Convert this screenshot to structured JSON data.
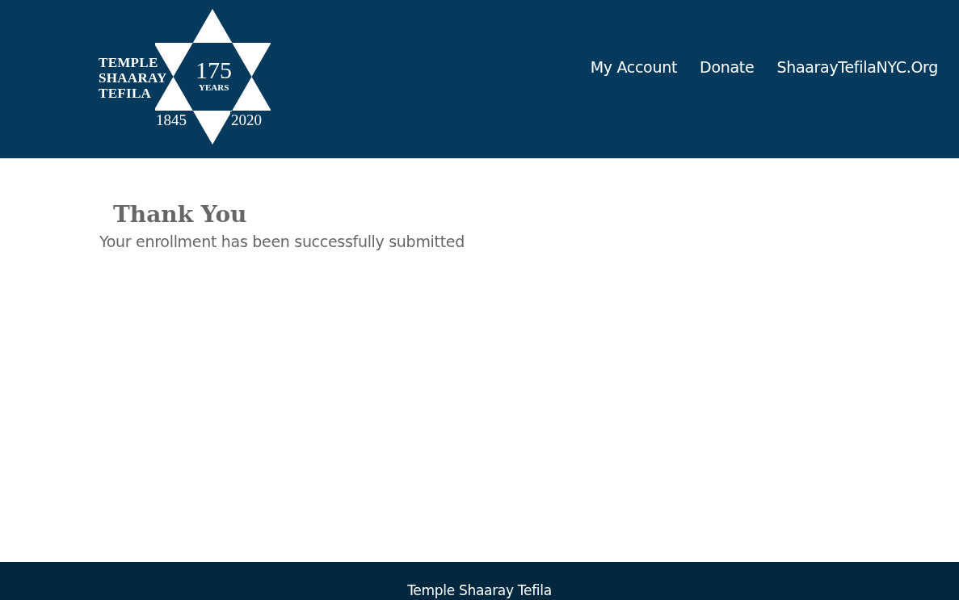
{
  "header": {
    "logo": {
      "name_lines": [
        "TEMPLE",
        "SHAARAY",
        "TEFILA"
      ],
      "anniversary": "175",
      "anniversary_label": "YEARS",
      "start_year": "1845",
      "end_year": "2020"
    },
    "nav": [
      "My Account",
      "Donate",
      "ShaarayTefilaNYC.Org"
    ]
  },
  "content": {
    "title": "Thank You",
    "message": "Your enrollment has been successfully submitted"
  },
  "footer": {
    "text": "Temple Shaaray Tefila"
  }
}
